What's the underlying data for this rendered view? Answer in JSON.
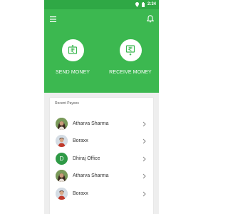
{
  "status_bar": {
    "time": "2:34",
    "icons": [
      "location-icon",
      "battery-icon"
    ]
  },
  "header": {
    "menu_icon": "menu-icon",
    "notification_icon": "bell-icon",
    "background": "#3cb850",
    "actions": [
      {
        "label": "SEND MONEY",
        "icon": "rupee-send-icon"
      },
      {
        "label": "RECEIVE MONEY",
        "icon": "rupee-receive-icon"
      }
    ]
  },
  "recent_payees": {
    "title": "Recent Payees",
    "items": [
      {
        "name": "Atharva Sharma",
        "avatar": "photo-avatar-woman"
      },
      {
        "name": "Boraxx",
        "avatar": "photo-avatar-man"
      },
      {
        "name": "Dhiraj Office",
        "avatar_letter": "D"
      },
      {
        "name": "Atharva Sharma",
        "avatar": "photo-avatar-woman"
      },
      {
        "name": "Boraxx",
        "avatar": "photo-avatar-man"
      }
    ]
  }
}
